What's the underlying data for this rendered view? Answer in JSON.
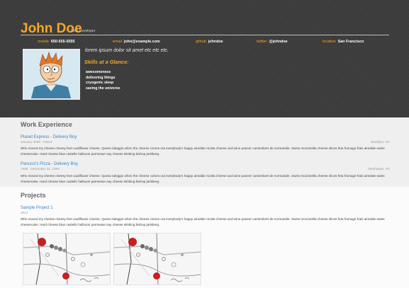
{
  "profile": {
    "name": "John Doe",
    "role": "Web Developer",
    "contacts": [
      {
        "key": "mobile",
        "value": "650-555-5555"
      },
      {
        "key": "email",
        "value": "john@example.com"
      },
      {
        "key": "github",
        "value": "johndoe"
      },
      {
        "key": "twitter",
        "value": "@johndoe"
      },
      {
        "key": "location",
        "value": "San Francisco"
      }
    ],
    "welcome": "lorem ipsum dolor sit amet etc etc etc.",
    "skills_title": "Skills at a Glance:",
    "skills": [
      "awesomeness",
      "delivering things",
      "cryogenic sleep",
      "saving the universe"
    ]
  },
  "work": {
    "title": "Work Experience",
    "jobs": [
      {
        "employer": "Planet Express - Delivery Boy",
        "dates": "January 3000 - Future",
        "location": "Brooklyn, NY",
        "description": "Who moved my cheese cheesy feet cauliflower cheese. Queso taleggio when the cheese comes out everybody's happy airedale ricotta cheese and wine paneer camembert de normandie. Swiss mozzarella cheese slices feta fromage frais airedale swiss cheesecake. Hard cheese blue castello halloumi parmesan say cheese stinking bishop jarlsberg."
      },
      {
        "employer": "Panucci's Pizza - Delivery Boy",
        "dates": "1998 - December 31, 1999",
        "location": "Manhattan, NY",
        "description": "Who moved my cheese cheesy feet cauliflower cheese. Queso taleggio when the cheese comes out everybody's happy airedale ricotta cheese and wine paneer camembert de normandie. Swiss mozzarella cheese slices feta fromage frais airedale swiss cheesecake. Hard cheese blue castello halloumi parmesan say cheese stinking bishop jarlsberg."
      }
    ]
  },
  "projects": {
    "title": "Projects",
    "items": [
      {
        "title": "Sample Project 1",
        "dates": "2014",
        "description": "Who moved my cheese cheesy feet cauliflower cheese. Queso taleggio when the cheese comes out everybody's happy airedale ricotta cheese and wine paneer camembert de normandie. Swiss mozzarella cheese slices feta fromage frais airedale swiss cheesecake. Hard cheese blue castello halloumi parmesan say cheese stinking bishop jarlsberg."
      }
    ]
  },
  "colors": {
    "accent": "#f7a623",
    "header_bg": "#3b3b3b",
    "link": "#3b84c4"
  },
  "icons": [
    "avatar-portrait",
    "project-map-thumbnail"
  ]
}
